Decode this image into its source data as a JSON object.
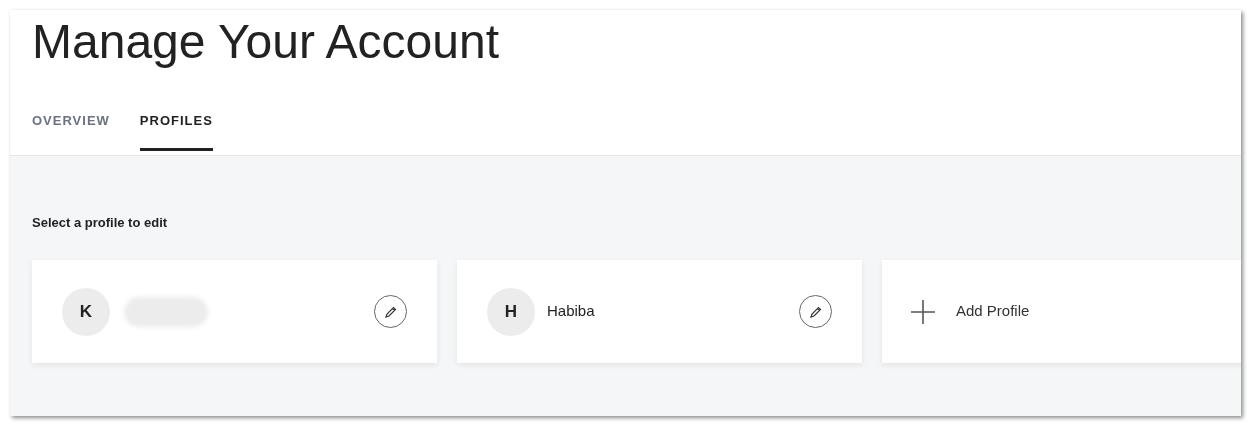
{
  "page": {
    "title": "Manage Your Account"
  },
  "tabs": [
    {
      "label": "OVERVIEW",
      "selected": false
    },
    {
      "label": "PROFILES",
      "selected": true
    }
  ],
  "profiles_section": {
    "heading": "Select a profile to edit",
    "profiles": [
      {
        "kind": "profile",
        "initial": "K",
        "redacted": true
      },
      {
        "kind": "profile",
        "initial": "H",
        "name": "Habiba",
        "redacted": false
      },
      {
        "kind": "add",
        "label": "Add Profile"
      }
    ]
  }
}
